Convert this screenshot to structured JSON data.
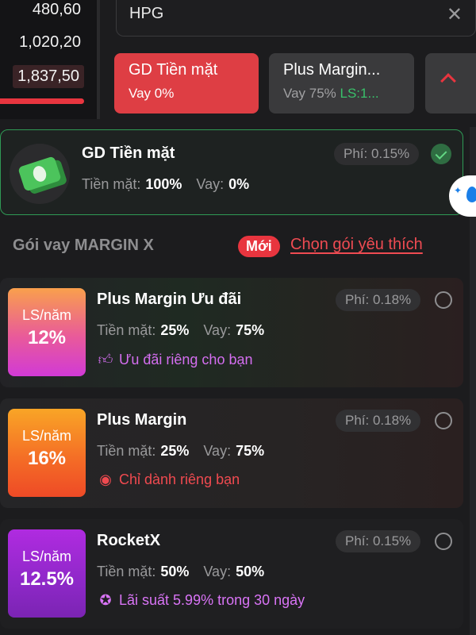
{
  "prices": [
    "480,60",
    "1,020,20",
    "1,837,50"
  ],
  "search": {
    "value": "HPG"
  },
  "tabs": {
    "cash": {
      "title": "GD Tiền mặt",
      "sub": "Vay 0%"
    },
    "margin": {
      "title": "Plus Margin...",
      "sub": "Vay 75%",
      "ls": "LS:1..."
    }
  },
  "selected": {
    "title": "GD Tiền mặt",
    "fee": "Phí: 0.15%",
    "cash_label": "Tiền mặt:",
    "cash_value": "100%",
    "loan_label": "Vay:",
    "loan_value": "0%"
  },
  "section": {
    "title": "Gói vay MARGIN X",
    "badge": "Mới",
    "link": "Chọn gói yêu thích"
  },
  "packages": [
    {
      "rate_label": "LS/năm",
      "rate": "12%",
      "title": "Plus Margin Ưu đãi",
      "fee": "Phí: 0.18%",
      "cash_label": "Tiền mặt:",
      "cash_value": "25%",
      "loan_label": "Vay:",
      "loan_value": "75%",
      "promo": "Ưu đãi riêng cho bạn"
    },
    {
      "rate_label": "LS/năm",
      "rate": "16%",
      "title": "Plus Margin",
      "fee": "Phí: 0.18%",
      "cash_label": "Tiền mặt:",
      "cash_value": "25%",
      "loan_label": "Vay:",
      "loan_value": "75%",
      "promo": "Chỉ dành riêng bạn"
    },
    {
      "rate_label": "LS/năm",
      "rate": "12.5%",
      "title": "RocketX",
      "fee": "Phí: 0.15%",
      "cash_label": "Tiền mặt:",
      "cash_value": "50%",
      "loan_label": "Vay:",
      "loan_value": "50%",
      "promo": "Lãi suất 5.99% trong 30 ngày"
    }
  ],
  "colors": {
    "accent_red": "#e8353f",
    "success_green": "#2f9a55",
    "promo_purple": "#d46ef0"
  }
}
